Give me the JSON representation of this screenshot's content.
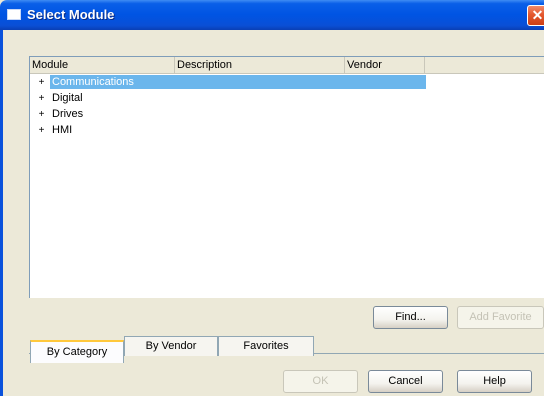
{
  "window": {
    "title": "Select Module"
  },
  "listview": {
    "columns": [
      "Module",
      "Description",
      "Vendor"
    ],
    "rows": [
      {
        "expander": "+",
        "label": "Communications",
        "selected": true
      },
      {
        "expander": "+",
        "label": "Digital",
        "selected": false
      },
      {
        "expander": "+",
        "label": "Drives",
        "selected": false
      },
      {
        "expander": "+",
        "label": "HMI",
        "selected": false
      }
    ]
  },
  "buttons": {
    "find": "Find...",
    "add_favorite": "Add Favorite",
    "ok": "OK",
    "cancel": "Cancel",
    "help": "Help"
  },
  "tabs": [
    {
      "label": "By Category",
      "active": true
    },
    {
      "label": "By Vendor",
      "active": false
    },
    {
      "label": "Favorites",
      "active": false
    }
  ],
  "colors": {
    "titlebar": "#0054e3",
    "selection": "#6bb6ec",
    "close": "#e4582e"
  }
}
